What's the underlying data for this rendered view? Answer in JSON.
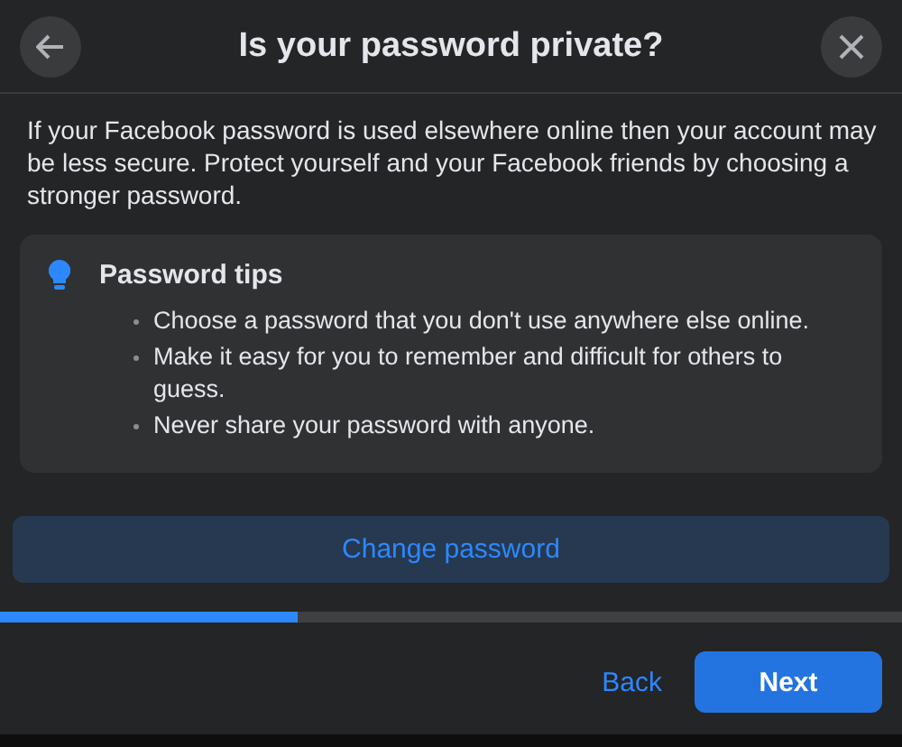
{
  "dialog": {
    "title": "Is your password private?"
  },
  "intro": "If your Facebook password is used elsewhere online then your account may be less secure. Protect yourself and your Facebook friends by choosing a stronger password.",
  "tips": {
    "title": "Password tips",
    "items": [
      "Choose a password that you don't use anywhere else online.",
      "Make it easy for you to remember and difficult for others to guess.",
      "Never share your password with anyone."
    ]
  },
  "change_button": "Change password",
  "progress": {
    "level": 0.33
  },
  "footer": {
    "back": "Back",
    "next": "Next"
  }
}
